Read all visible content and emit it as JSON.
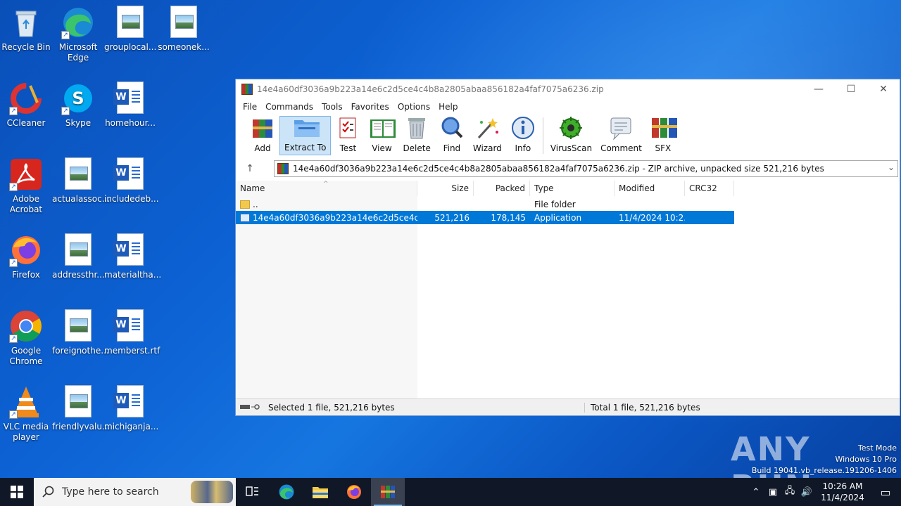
{
  "desktop": {
    "icons": [
      {
        "label": "Recycle Bin",
        "icon": "recycle-bin-icon"
      },
      {
        "label": "Microsoft Edge",
        "icon": "edge-icon"
      },
      {
        "label": "grouplocal...",
        "icon": "image-file-icon"
      },
      {
        "label": "someonek...",
        "icon": "image-file-icon"
      },
      {
        "label": "CCleaner",
        "icon": "ccleaner-icon"
      },
      {
        "label": "Skype",
        "icon": "skype-icon"
      },
      {
        "label": "homehour...",
        "icon": "word-doc-icon"
      },
      {
        "label": "Adobe Acrobat",
        "icon": "acrobat-icon"
      },
      {
        "label": "actualassoc...",
        "icon": "image-file-icon"
      },
      {
        "label": "includedeb...",
        "icon": "word-doc-icon"
      },
      {
        "label": "Firefox",
        "icon": "firefox-icon"
      },
      {
        "label": "addressthr...",
        "icon": "image-file-icon"
      },
      {
        "label": "materialtha...",
        "icon": "word-doc-icon"
      },
      {
        "label": "Google Chrome",
        "icon": "chrome-icon"
      },
      {
        "label": "foreignothe...",
        "icon": "image-file-icon"
      },
      {
        "label": "memberst.rtf",
        "icon": "word-doc-icon"
      },
      {
        "label": "VLC media player",
        "icon": "vlc-icon"
      },
      {
        "label": "friendlyvalu...",
        "icon": "image-file-icon"
      },
      {
        "label": "michiganja...",
        "icon": "word-doc-icon"
      }
    ]
  },
  "window": {
    "title": "14e4a60df3036a9b223a14e6c2d5ce4c4b8a2805abaa856182a4faf7075a6236.zip",
    "controls": {
      "minimize": "—",
      "maximize": "☐",
      "close": "✕"
    },
    "menu": [
      "File",
      "Commands",
      "Tools",
      "Favorites",
      "Options",
      "Help"
    ],
    "toolbar": [
      {
        "label": "Add",
        "icon": "add-archive-icon"
      },
      {
        "label": "Extract To",
        "icon": "extract-folder-icon"
      },
      {
        "label": "Test",
        "icon": "test-checklist-icon"
      },
      {
        "label": "View",
        "icon": "view-book-icon"
      },
      {
        "label": "Delete",
        "icon": "trash-icon"
      },
      {
        "label": "Find",
        "icon": "magnifier-icon"
      },
      {
        "label": "Wizard",
        "icon": "wand-icon"
      },
      {
        "label": "Info",
        "icon": "info-icon"
      },
      {
        "label": "VirusScan",
        "icon": "virus-scan-icon"
      },
      {
        "label": "Comment",
        "icon": "comment-icon"
      },
      {
        "label": "SFX",
        "icon": "sfx-icon"
      }
    ],
    "address": "14e4a60df3036a9b223a14e6c2d5ce4c4b8a2805abaa856182a4faf7075a6236.zip - ZIP archive, unpacked size 521,216 bytes",
    "columns": [
      "Name",
      "Size",
      "Packed",
      "Type",
      "Modified",
      "CRC32"
    ],
    "rows": [
      {
        "name": "..",
        "size": "",
        "packed": "",
        "type": "File folder",
        "modified": "",
        "crc": ""
      },
      {
        "name": "14e4a60df3036a9b223a14e6c2d5ce4c4b8a...",
        "size": "521,216",
        "packed": "178,145",
        "type": "Application",
        "modified": "11/4/2024 10:2...",
        "crc": ""
      }
    ],
    "status_left": "Selected 1 file, 521,216 bytes",
    "status_right": "Total 1 file, 521,216 bytes"
  },
  "watermark": {
    "brand": "ANY RUN",
    "line1": "Test Mode",
    "line2": "Windows 10 Pro",
    "line3": "Build 19041.vb_release.191206-1406"
  },
  "taskbar": {
    "search_placeholder": "Type here to search",
    "time": "10:26 AM",
    "date": "11/4/2024"
  }
}
